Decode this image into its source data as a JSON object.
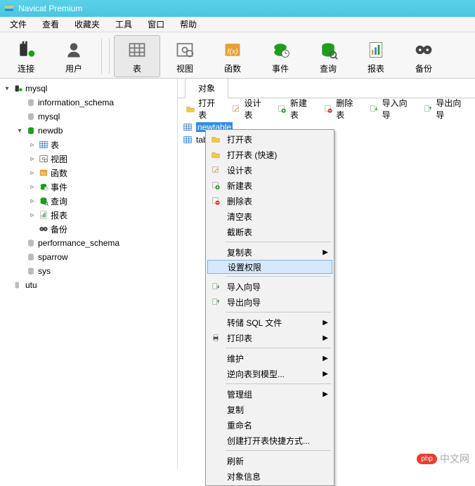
{
  "title": "Navicat Premium",
  "menus": [
    "文件",
    "查看",
    "收藏夹",
    "工具",
    "窗口",
    "帮助"
  ],
  "toolbar": [
    {
      "id": "connect",
      "label": "连接",
      "icon": "plug"
    },
    {
      "id": "user",
      "label": "用户",
      "icon": "user"
    },
    {
      "id": "table",
      "label": "表",
      "icon": "table",
      "active": true
    },
    {
      "id": "view",
      "label": "视图",
      "icon": "view"
    },
    {
      "id": "function",
      "label": "函数",
      "icon": "fx"
    },
    {
      "id": "event",
      "label": "事件",
      "icon": "clock"
    },
    {
      "id": "query",
      "label": "查询",
      "icon": "query"
    },
    {
      "id": "report",
      "label": "报表",
      "icon": "report"
    },
    {
      "id": "backup",
      "label": "备份",
      "icon": "tape"
    }
  ],
  "tree": [
    {
      "depth": 0,
      "twisty": "▾",
      "icon": "conn-on",
      "label": "mysql"
    },
    {
      "depth": 1,
      "twisty": "",
      "icon": "db",
      "label": "information_schema"
    },
    {
      "depth": 1,
      "twisty": "",
      "icon": "db",
      "label": "mysql"
    },
    {
      "depth": 1,
      "twisty": "▾",
      "icon": "db-on",
      "label": "newdb"
    },
    {
      "depth": 2,
      "twisty": "▹",
      "icon": "table",
      "label": "表"
    },
    {
      "depth": 2,
      "twisty": "▹",
      "icon": "view",
      "label": "视图"
    },
    {
      "depth": 2,
      "twisty": "▹",
      "icon": "fx",
      "label": "函数"
    },
    {
      "depth": 2,
      "twisty": "▹",
      "icon": "clock",
      "label": "事件"
    },
    {
      "depth": 2,
      "twisty": "▹",
      "icon": "query",
      "label": "查询"
    },
    {
      "depth": 2,
      "twisty": "▹",
      "icon": "report",
      "label": "报表"
    },
    {
      "depth": 2,
      "twisty": "",
      "icon": "tape",
      "label": "备份"
    },
    {
      "depth": 1,
      "twisty": "",
      "icon": "db",
      "label": "performance_schema"
    },
    {
      "depth": 1,
      "twisty": "",
      "icon": "db",
      "label": "sparrow"
    },
    {
      "depth": 1,
      "twisty": "",
      "icon": "db",
      "label": "sys"
    },
    {
      "depth": 0,
      "twisty": "",
      "icon": "conn-off",
      "label": "utu"
    }
  ],
  "tab_label": "对象",
  "object_toolbar": [
    {
      "id": "open",
      "label": "打开表",
      "icon": "open"
    },
    {
      "id": "design",
      "label": "设计表",
      "icon": "design"
    },
    {
      "id": "new",
      "label": "新建表",
      "icon": "new"
    },
    {
      "id": "delete",
      "label": "删除表",
      "icon": "delete"
    },
    {
      "id": "import",
      "label": "导入向导",
      "icon": "import"
    },
    {
      "id": "export",
      "label": "导出向导",
      "icon": "export"
    }
  ],
  "list": [
    {
      "label": "newtable",
      "selected": true
    },
    {
      "label": "table1",
      "selected": false
    }
  ],
  "context_menu": [
    {
      "type": "item",
      "icon": "open",
      "label": "打开表"
    },
    {
      "type": "item",
      "icon": "open",
      "label": "打开表 (快速)"
    },
    {
      "type": "item",
      "icon": "design",
      "label": "设计表"
    },
    {
      "type": "item",
      "icon": "new",
      "label": "新建表"
    },
    {
      "type": "item",
      "icon": "delete",
      "label": "删除表"
    },
    {
      "type": "item",
      "icon": "",
      "label": "清空表"
    },
    {
      "type": "item",
      "icon": "",
      "label": "截断表"
    },
    {
      "type": "sep"
    },
    {
      "type": "item",
      "icon": "",
      "label": "复制表",
      "sub": true
    },
    {
      "type": "item",
      "icon": "",
      "label": "设置权限",
      "hl": true
    },
    {
      "type": "sep"
    },
    {
      "type": "item",
      "icon": "import",
      "label": "导入向导"
    },
    {
      "type": "item",
      "icon": "export",
      "label": "导出向导"
    },
    {
      "type": "sep"
    },
    {
      "type": "item",
      "icon": "",
      "label": "转储 SQL 文件",
      "sub": true
    },
    {
      "type": "item",
      "icon": "print",
      "label": "打印表",
      "sub": true
    },
    {
      "type": "sep"
    },
    {
      "type": "item",
      "icon": "",
      "label": "维护",
      "sub": true
    },
    {
      "type": "item",
      "icon": "",
      "label": "逆向表到模型...",
      "sub": true
    },
    {
      "type": "sep"
    },
    {
      "type": "item",
      "icon": "",
      "label": "管理组",
      "sub": true
    },
    {
      "type": "item",
      "icon": "",
      "label": "复制"
    },
    {
      "type": "item",
      "icon": "",
      "label": "重命名"
    },
    {
      "type": "item",
      "icon": "",
      "label": "创建打开表快捷方式..."
    },
    {
      "type": "sep"
    },
    {
      "type": "item",
      "icon": "",
      "label": "刷新"
    },
    {
      "type": "item",
      "icon": "",
      "label": "对象信息"
    }
  ],
  "watermark": {
    "pill": "php",
    "site": "中文网"
  }
}
